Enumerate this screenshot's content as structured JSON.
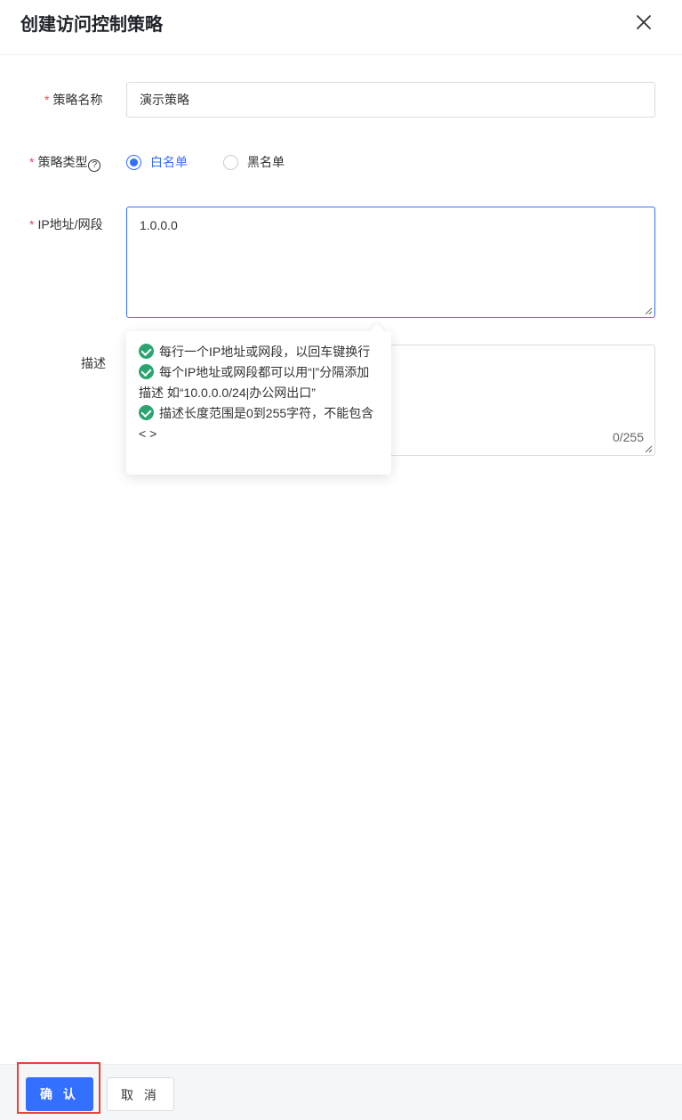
{
  "header": {
    "title": "创建访问控制策略"
  },
  "form": {
    "name": {
      "required_mark": "*",
      "label": "策略名称",
      "value": "演示策略"
    },
    "type": {
      "required_mark": "*",
      "label": "策略类型",
      "help_glyph": "?",
      "options": [
        {
          "label": "白名单",
          "checked": true
        },
        {
          "label": "黑名单",
          "checked": false
        }
      ]
    },
    "ip": {
      "required_mark": "*",
      "label": "IP地址/网段",
      "value": "1.0.0.0"
    },
    "desc": {
      "label": "描述",
      "value": "",
      "counter": "0/255"
    }
  },
  "tooltip": {
    "lines": [
      "每行一个IP地址或网段，以回车键换行",
      "每个IP地址或网段都可以用“|”分隔添加描述 如“10.0.0.0/24|办公网出口”",
      "描述长度范围是0到255字符，不能包含< >"
    ]
  },
  "footer": {
    "confirm_label": "确 认",
    "cancel_label": "取 消"
  },
  "colors": {
    "primary": "#3370ff",
    "required": "#e34d59",
    "success": "#2ba471",
    "highlight": "#e5443b"
  }
}
